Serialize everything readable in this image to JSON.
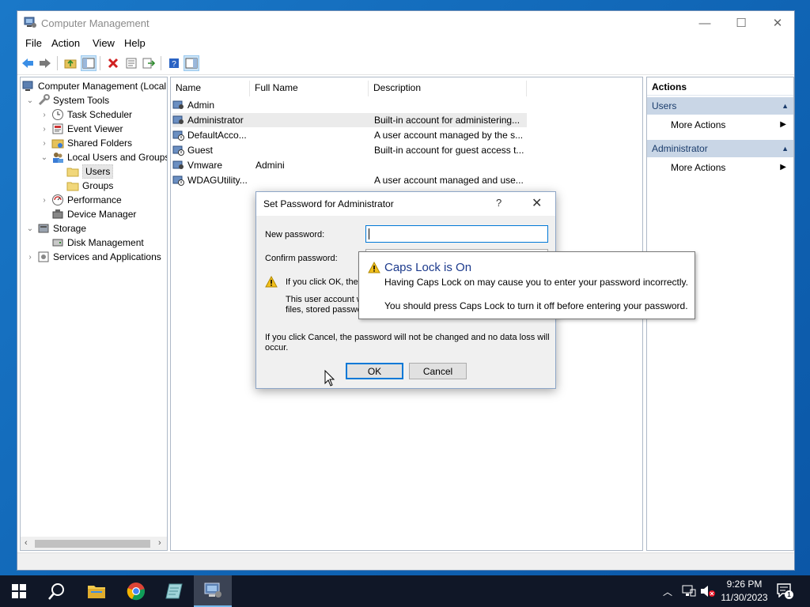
{
  "window": {
    "title": "Computer Management",
    "minimize": "—",
    "maximize": "☐",
    "close": "✕"
  },
  "menu": [
    "File",
    "Action",
    "View",
    "Help"
  ],
  "tree": {
    "root": "Computer Management (Local",
    "system_tools": "System Tools",
    "task_scheduler": "Task Scheduler",
    "event_viewer": "Event Viewer",
    "shared_folders": "Shared Folders",
    "local_users_groups": "Local Users and Groups",
    "users": "Users",
    "groups": "Groups",
    "performance": "Performance",
    "device_manager": "Device Manager",
    "storage": "Storage",
    "disk_management": "Disk Management",
    "services_apps": "Services and Applications"
  },
  "list": {
    "columns": [
      "Name",
      "Full Name",
      "Description"
    ],
    "rows": [
      {
        "name": "Admin",
        "full": "",
        "desc": ""
      },
      {
        "name": "Administrator",
        "full": "",
        "desc": "Built-in account for administering..."
      },
      {
        "name": "DefaultAcco...",
        "full": "",
        "desc": "A user account managed by the s..."
      },
      {
        "name": "Guest",
        "full": "",
        "desc": "Built-in account for guest access t..."
      },
      {
        "name": "Vmware",
        "full": "Admini",
        "desc": ""
      },
      {
        "name": "WDAGUtility...",
        "full": "",
        "desc": "A user account managed and use..."
      }
    ]
  },
  "actions": {
    "header": "Actions",
    "section1": "Users",
    "section1_item": "More Actions",
    "section2": "Administrator",
    "section2_item": "More Actions"
  },
  "dialog": {
    "title": "Set Password for Administrator",
    "help": "?",
    "close": "✕",
    "new_password_label": "New password:",
    "confirm_password_label": "Confirm password:",
    "warning_line1": "If you click OK, the f",
    "warning_line2": "This user account w",
    "warning_line3": "files, stored passwo",
    "cancel_note_line1": "If you click Cancel, the password will not be changed and no data loss will",
    "cancel_note_line2": "occur.",
    "ok": "OK",
    "cancel": "Cancel"
  },
  "tooltip": {
    "title": "Caps Lock is On",
    "line1": "Having Caps Lock on may cause you to enter your password incorrectly.",
    "line2": "You should press Caps Lock to turn it off before entering your password."
  },
  "taskbar": {
    "time": "9:26 PM",
    "date": "11/30/2023",
    "notification_count": "1"
  },
  "colors": {
    "desktop": "#1a78c8",
    "taskbar": "#101727",
    "accent": "#0078d7",
    "action_header": "#c9d6e6"
  }
}
